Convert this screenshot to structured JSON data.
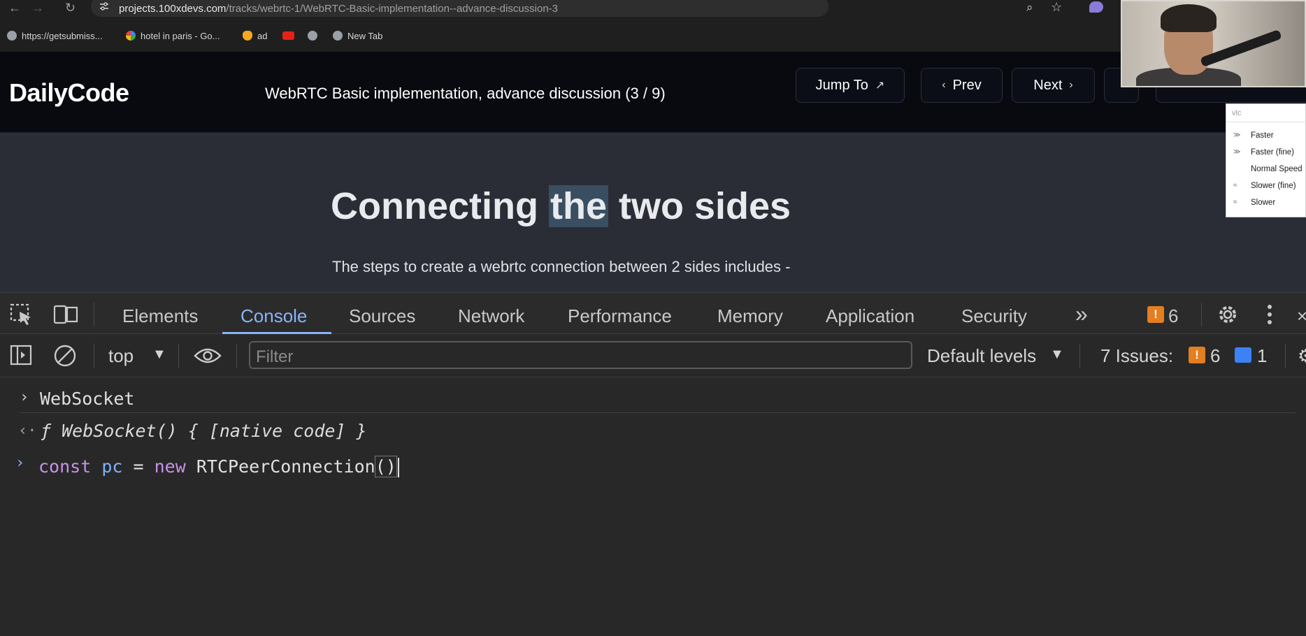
{
  "browser": {
    "url_domain": "projects.100xdevs.com",
    "url_path": "/tracks/webrtc-1/WebRTC-Basic-implementation--advance-discussion-3",
    "bookmarks": [
      "https://getsubmiss...",
      "hotel in paris - Go...",
      "ad",
      "New Tab"
    ]
  },
  "site": {
    "logo": "DailyCode",
    "lesson_title": "WebRTC Basic implementation, advance discussion (3 / 9)",
    "jump_to": "Jump To",
    "prev": "Prev",
    "next": "Next"
  },
  "content": {
    "heading_pre": "Connecting ",
    "heading_highlight": "the",
    "heading_post": " two sides",
    "paragraph": "The steps to create a webrtc connection between 2 sides includes -"
  },
  "vlc_menu": {
    "search": "vlc",
    "items": [
      "Faster",
      "Faster (fine)",
      "Normal Speed",
      "Slower (fine)",
      "Slower"
    ]
  },
  "devtools": {
    "tabs": [
      "Elements",
      "Console",
      "Sources",
      "Network",
      "Performance",
      "Memory",
      "Application",
      "Security"
    ],
    "more": "»",
    "warning_count": "6",
    "context": "top",
    "filter_placeholder": "Filter",
    "levels": "Default levels",
    "issues_label": "7 Issues:",
    "issues_warn": "6",
    "issues_info": "1"
  },
  "console": {
    "input1": "WebSocket",
    "result1": "ƒ WebSocket() { [native code] }",
    "input2_kw1": "const",
    "input2_var": "pc",
    "input2_eq": "=",
    "input2_kw2": "new",
    "input2_cls": "RTCPeerConnection",
    "input2_parens": "()"
  },
  "colors": {
    "accent": "#8ab4f8",
    "warning": "#e37e21",
    "keyword": "#c792ea",
    "result_italic": "#e06c5a"
  }
}
